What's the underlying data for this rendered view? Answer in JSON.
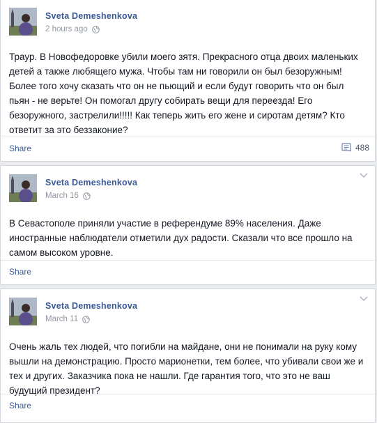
{
  "posts": [
    {
      "author": "Sveta Demeshenkova",
      "time": "2 hours ago",
      "privacy_icon": "globe-icon",
      "has_menu_chevron": false,
      "text": "Траур. В Новофедоровке убили моего зятя. Прекрасного отца двоих маленьких детей а также любящего мужа. Чтобы там ни говорили он был безоружным! Более того хочу сказать что он не пьющий и если будут говорить что он был пьян - не верьте! Он помогал другу собирать вещи для переезда! Его безоружного, застрелили!!!!! Как теперь жить его жене и сиротам детям? Кто ответит за это беззаконие?",
      "share_label": "Share",
      "shares_count": "488"
    },
    {
      "author": "Sveta Demeshenkova",
      "time": "March 16",
      "privacy_icon": "globe-icon",
      "has_menu_chevron": true,
      "text": "В Севастополе приняли участие в референдуме 89% населения. Даже иностранные наблюдатели отметили дух радости. Сказали что все прошло на самом высоком уровне.",
      "share_label": "Share"
    },
    {
      "author": "Sveta Demeshenkova",
      "time": "March 11",
      "privacy_icon": "globe-icon",
      "has_menu_chevron": true,
      "text": "Очень жаль тех людей, что погибли на майдане, они не понимали на руку кому вышли на демонстрацию. Просто марионетки, тем более, что убивали свои же и тех и других. Заказчика пока не нашли. Где гарантия того, что это не ваш будущий президент?",
      "share_label": "Share"
    }
  ],
  "colors": {
    "link": "#3b5998",
    "meta": "#9197a3",
    "text": "#141823",
    "page_bg": "#e9ebee"
  }
}
